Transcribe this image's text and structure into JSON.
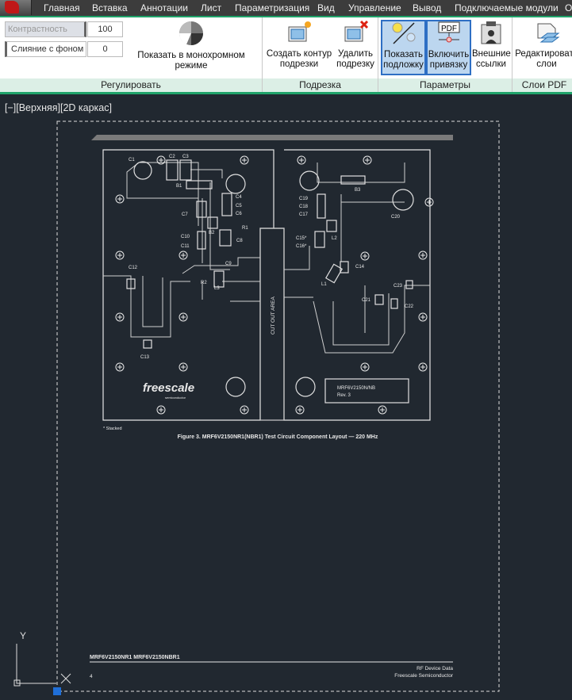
{
  "menu": {
    "items": [
      "Главная",
      "Вставка",
      "Аннотации",
      "Лист",
      "Параметризация",
      "Вид",
      "Управление",
      "Вывод",
      "Подключаемые модули",
      "О"
    ]
  },
  "ribbon": {
    "adjust": {
      "contrast_label": "Контрастность",
      "contrast_value": "100",
      "fade_label": "Слияние с фоном",
      "fade_value": "0",
      "monochrome_label": "Показать в монохромном режиме",
      "panel_label": "Регулировать"
    },
    "clip": {
      "create_label": [
        "Создать контур",
        "подрезки"
      ],
      "delete_label": [
        "Удалить",
        "подрезку"
      ],
      "panel_label": "Подрезка"
    },
    "options": {
      "show_label": [
        "Показать",
        "подложку"
      ],
      "snap_label": [
        "Включить",
        "привязку"
      ],
      "xref_label": [
        "Внешние",
        "ссылки"
      ],
      "pdf_icon_text": "PDF",
      "panel_label": "Параметры"
    },
    "layers": {
      "edit_label": [
        "Редактировать",
        "слои"
      ],
      "panel_label": "Слои PDF"
    }
  },
  "viewport": {
    "label": "[−][Верхняя][2D каркас]"
  },
  "pdf": {
    "components": [
      "C1",
      "C2",
      "C3",
      "B1",
      "C4",
      "C5",
      "C6",
      "C7",
      "B2",
      "R1",
      "C10",
      "C11",
      "C8",
      "C9",
      "R2",
      "L3",
      "C12",
      "C13",
      "C19",
      "C18",
      "C17",
      "B3",
      "C20",
      "L2",
      "C15*",
      "C16*",
      "C14",
      "L1",
      "C23",
      "C21",
      "C22"
    ],
    "cutout": "CUT OUT AREA",
    "logo": "freescale",
    "logo_sub": "semiconductor",
    "board_label": [
      "MRF6V2150N/NB",
      "Rev. 3"
    ],
    "stacked_note": "* Stacked",
    "figure_caption": "Figure 3. MRF6V2150NR1(NBR1) Test Circuit Component Layout — 220 MHz",
    "footer_left": "MRF6V2150NR1 MRF6V2150NBR1",
    "page_number": "4",
    "footer_right": [
      "RF Device Data",
      "Freescale Semiconductor"
    ]
  },
  "ucs": {
    "y_label": "Y"
  },
  "colors": {
    "ribbon_accent": "#1fa36a",
    "viewport_bg": "#212830",
    "active_button": "#bcd6ef"
  }
}
